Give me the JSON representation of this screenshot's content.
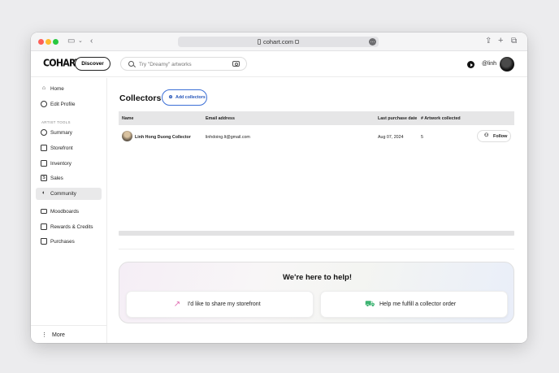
{
  "browser": {
    "url": "cohart.com"
  },
  "header": {
    "logo": "COHART",
    "discover_label": "Discover",
    "search_placeholder": "Try \"Dreamy\" artworks",
    "username": "@linh"
  },
  "sidebar": {
    "top_items": [
      {
        "label": "Home",
        "icon": "home-icon"
      },
      {
        "label": "Edit Profile",
        "icon": "profile-icon"
      }
    ],
    "section_label": "ARTIST TOOLS",
    "tool_items": [
      {
        "label": "Summary",
        "icon": "summary-icon"
      },
      {
        "label": "Storefront",
        "icon": "storefront-icon"
      },
      {
        "label": "Inventory",
        "icon": "inventory-icon"
      },
      {
        "label": "Sales",
        "icon": "dollar-icon"
      },
      {
        "label": "Community",
        "icon": "community-icon",
        "active": true
      }
    ],
    "extra_items": [
      {
        "label": "Moodboards",
        "icon": "folder-icon"
      },
      {
        "label": "Rewards & Credits",
        "icon": "rewards-icon"
      },
      {
        "label": "Purchases",
        "icon": "bag-icon"
      }
    ],
    "more_label": "More"
  },
  "main": {
    "title": "Collectors",
    "add_collectors_label": "Add collectors",
    "table": {
      "headers": [
        "Name",
        "Email address",
        "Last purchase date",
        "# Artwork collected"
      ],
      "rows": [
        {
          "name": "Linh Hong Duong Collector",
          "email": "linhdoing.lt@gmail.com",
          "last_purchase": "Aug 07, 2024",
          "artworks": "5",
          "action": "Follow"
        }
      ]
    },
    "help": {
      "title": "We're here to help!",
      "buttons": [
        {
          "label": "I'd like to share my storefront",
          "icon": "share-icon"
        },
        {
          "label": "Help me fulfill a collector order",
          "icon": "truck-icon"
        }
      ]
    }
  },
  "colors": {
    "accent": "#3b6fd6",
    "active_nav_bg": "#e9e9ea"
  }
}
